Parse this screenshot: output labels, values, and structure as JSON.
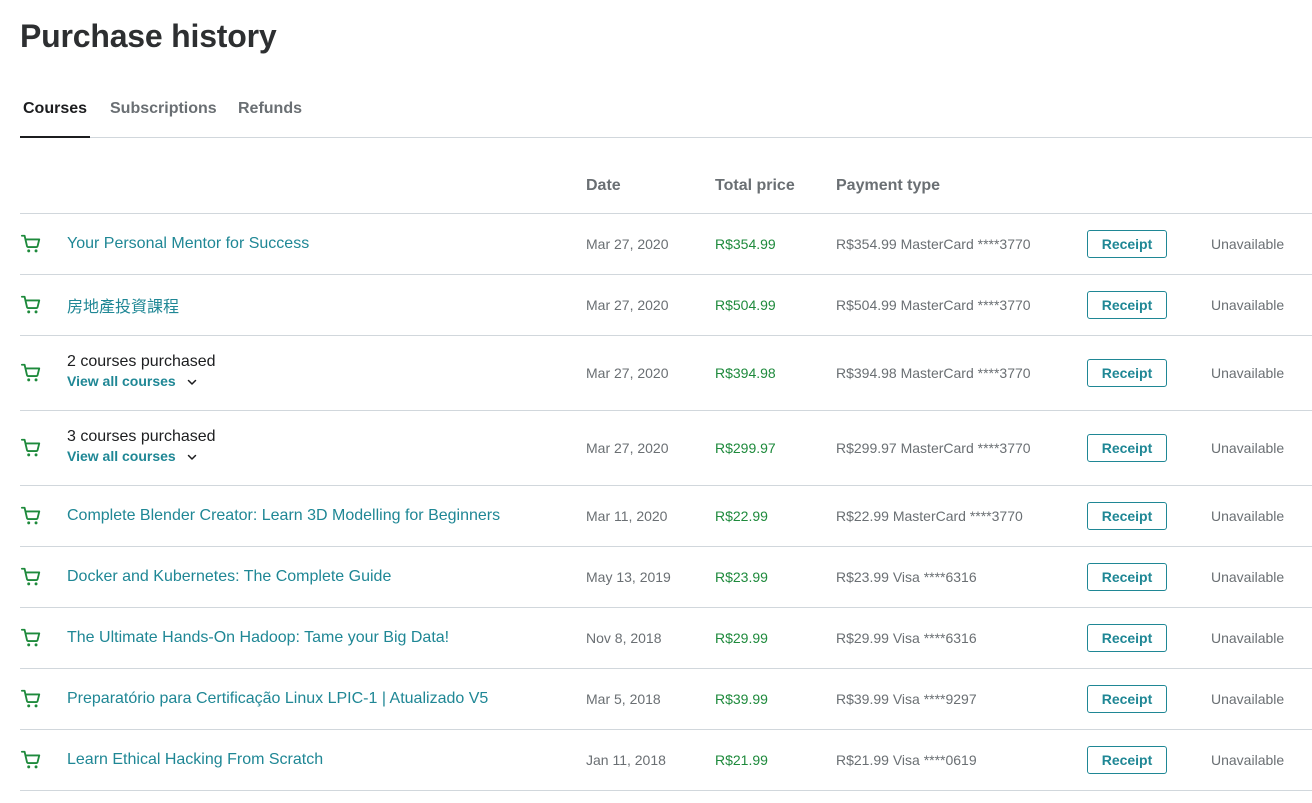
{
  "page": {
    "title": "Purchase history"
  },
  "tabs": [
    {
      "label": "Courses",
      "active": true
    },
    {
      "label": "Subscriptions",
      "active": false
    },
    {
      "label": "Refunds",
      "active": false
    }
  ],
  "table": {
    "headers": {
      "date": "Date",
      "price": "Total price",
      "payment": "Payment type"
    },
    "receipt_label": "Receipt",
    "rows": [
      {
        "type": "single",
        "icon": "cart-icon",
        "title": "Your Personal Mentor for Success",
        "date": "Mar 27, 2020",
        "price": "R$354.99",
        "payment": "R$354.99 MasterCard ****3770",
        "receipt": "Receipt",
        "status": "Unavailable"
      },
      {
        "type": "single",
        "icon": "cart-icon",
        "title": "房地產投資課程",
        "date": "Mar 27, 2020",
        "price": "R$504.99",
        "payment": "R$504.99 MasterCard ****3770",
        "receipt": "Receipt",
        "status": "Unavailable"
      },
      {
        "type": "multi",
        "icon": "cart-icon",
        "title": "2 courses purchased",
        "link": "View all courses",
        "date": "Mar 27, 2020",
        "price": "R$394.98",
        "payment": "R$394.98 MasterCard ****3770",
        "receipt": "Receipt",
        "status": "Unavailable"
      },
      {
        "type": "multi",
        "icon": "cart-icon",
        "title": "3 courses purchased",
        "link": "View all courses",
        "date": "Mar 27, 2020",
        "price": "R$299.97",
        "payment": "R$299.97 MasterCard ****3770",
        "receipt": "Receipt",
        "status": "Unavailable"
      },
      {
        "type": "single",
        "icon": "cart-icon",
        "title": "Complete Blender Creator: Learn 3D Modelling for Beginners",
        "date": "Mar 11, 2020",
        "price": "R$22.99",
        "payment": "R$22.99 MasterCard ****3770",
        "receipt": "Receipt",
        "status": "Unavailable"
      },
      {
        "type": "single",
        "icon": "cart-icon",
        "title": "Docker and Kubernetes: The Complete Guide",
        "date": "May 13, 2019",
        "price": "R$23.99",
        "payment": "R$23.99 Visa ****6316",
        "receipt": "Receipt",
        "status": "Unavailable"
      },
      {
        "type": "single",
        "icon": "cart-icon",
        "title": "The Ultimate Hands-On Hadoop: Tame your Big Data!",
        "date": "Nov 8, 2018",
        "price": "R$29.99",
        "payment": "R$29.99 Visa ****6316",
        "receipt": "Receipt",
        "status": "Unavailable"
      },
      {
        "type": "single",
        "icon": "cart-icon",
        "title": "Preparatório para Certificação Linux LPIC-1 | Atualizado V5",
        "date": "Mar 5, 2018",
        "price": "R$39.99",
        "payment": "R$39.99 Visa ****9297",
        "receipt": "Receipt",
        "status": "Unavailable"
      },
      {
        "type": "single",
        "icon": "cart-icon",
        "title": "Learn Ethical Hacking From Scratch",
        "date": "Jan 11, 2018",
        "price": "R$21.99",
        "payment": "R$21.99 Visa ****0619",
        "receipt": "Receipt",
        "status": "Unavailable"
      }
    ]
  },
  "colors": {
    "link": "#1f8795",
    "price": "#1e8a3c",
    "cart_icon": "#1e8a3c",
    "muted": "#6a6f73",
    "divider": "#d1d7dc"
  }
}
